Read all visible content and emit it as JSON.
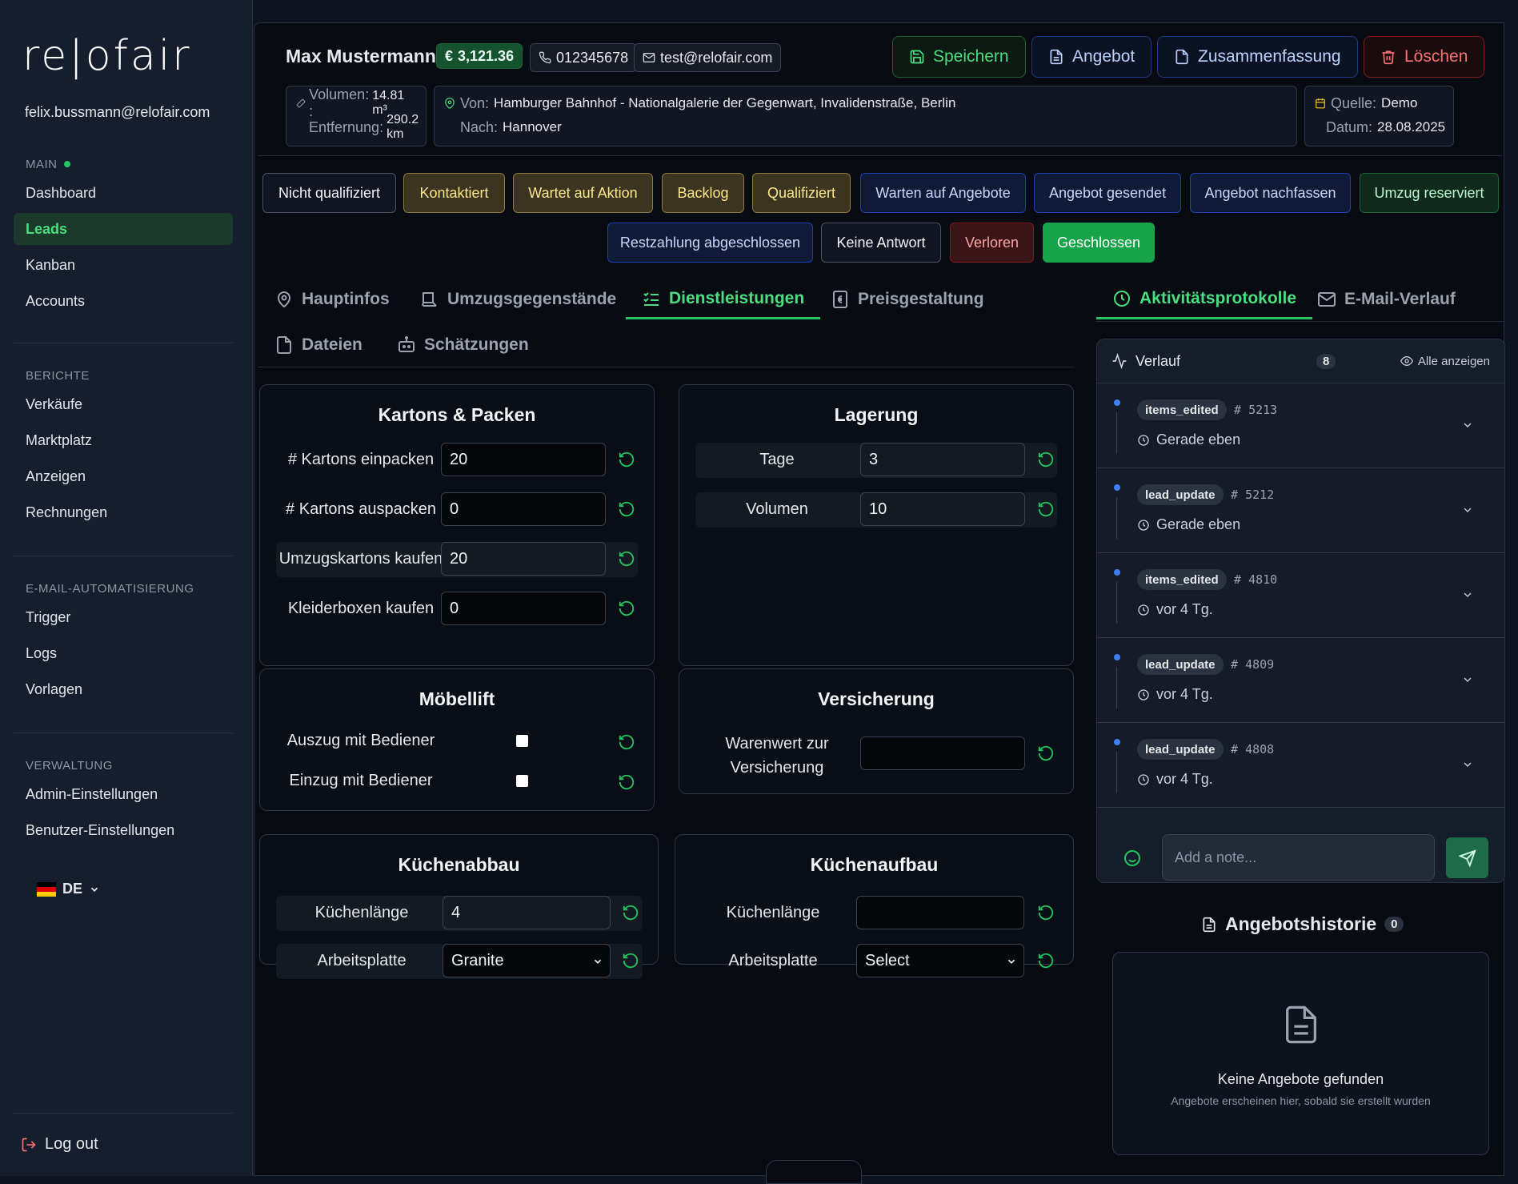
{
  "sidebar": {
    "logo": "re|ofair",
    "user_email": "felix.bussmann@relofair.com",
    "sections": [
      {
        "heading": "MAIN",
        "items": [
          {
            "label": "Dashboard"
          },
          {
            "label": "Leads"
          },
          {
            "label": "Kanban"
          },
          {
            "label": "Accounts"
          }
        ]
      },
      {
        "heading": "BERICHTE",
        "items": [
          {
            "label": "Verkäufe"
          },
          {
            "label": "Marktplatz"
          },
          {
            "label": "Anzeigen"
          },
          {
            "label": "Rechnungen"
          }
        ]
      },
      {
        "heading": "E-MAIL-AUTOMATISIERUNG",
        "items": [
          {
            "label": "Trigger"
          },
          {
            "label": "Logs"
          },
          {
            "label": "Vorlagen"
          }
        ]
      },
      {
        "heading": "VERWALTUNG",
        "items": [
          {
            "label": "Admin-Einstellungen"
          },
          {
            "label": "Benutzer-Einstellungen"
          }
        ]
      }
    ],
    "language": "DE",
    "logout": "Log out"
  },
  "header": {
    "name": "Max Mustermann",
    "price": "3,121.36",
    "currency": "€",
    "phone": "012345678",
    "email": "test@relofair.com",
    "buttons": {
      "save": "Speichern",
      "offer": "Angebot",
      "summary": "Zusammenfassung",
      "delete": "Löschen"
    },
    "volume_label": "Volumen: :",
    "volume_value": "14.81 m³",
    "distance_label": "Entfernung:",
    "distance_value": "290.2 km",
    "from_label": "Von:",
    "from_value": "Hamburger Bahnhof - Nationalgalerie der Gegenwart, Invalidenstraße, Berlin",
    "to_label": "Nach:",
    "to_value": "Hannover",
    "source_label": "Quelle:",
    "source_value": "Demo",
    "date_label": "Datum:",
    "date_value": "28.08.2025"
  },
  "stages": [
    {
      "label": "Nicht qualifiziert"
    },
    {
      "label": "Kontaktiert"
    },
    {
      "label": "Wartet auf Aktion"
    },
    {
      "label": "Backlog"
    },
    {
      "label": "Qualifiziert"
    },
    {
      "label": "Warten auf Angebote"
    },
    {
      "label": "Angebot gesendet"
    },
    {
      "label": "Angebot nachfassen"
    },
    {
      "label": "Umzug reserviert"
    },
    {
      "label": "Restzahlung abgeschlossen"
    },
    {
      "label": "Keine Antwort"
    },
    {
      "label": "Verloren"
    },
    {
      "label": "Geschlossen"
    }
  ],
  "tabs": [
    "Hauptinfos",
    "Umzugsgegenstände",
    "Dienstleistungen",
    "Preisgestaltung",
    "Dateien",
    "Schätzungen"
  ],
  "right_tabs": [
    "Aktivitätsprotokolle",
    "E-Mail-Verlauf"
  ],
  "services": {
    "kartons": {
      "title": "Kartons & Packen",
      "rows": [
        {
          "label": "# Kartons einpacken",
          "value": "20"
        },
        {
          "label": "# Kartons auspacken",
          "value": "0"
        },
        {
          "label": "Umzugskartons kaufen",
          "value": "20"
        },
        {
          "label": "Kleiderboxen kaufen",
          "value": "0"
        }
      ]
    },
    "lagerung": {
      "title": "Lagerung",
      "rows": [
        {
          "label": "Tage",
          "value": "3"
        },
        {
          "label": "Volumen",
          "value": "10"
        }
      ]
    },
    "moebellift": {
      "title": "Möbellift",
      "rows": [
        {
          "label": "Auszug mit Bediener",
          "checked": false
        },
        {
          "label": "Einzug mit Bediener",
          "checked": false
        }
      ]
    },
    "versicherung": {
      "title": "Versicherung",
      "row_label_1": "Warenwert zur",
      "row_label_2": "Versicherung",
      "value": ""
    },
    "kuechenabbau": {
      "title": "Küchenabbau",
      "length_label": "Küchenlänge",
      "length_value": "4",
      "counter_label": "Arbeitsplatte",
      "counter_value": "Granite"
    },
    "kuechenaufbau": {
      "title": "Küchenaufbau",
      "length_label": "Küchenlänge",
      "length_value": "",
      "counter_label": "Arbeitsplatte",
      "counter_value": "Select"
    }
  },
  "activity": {
    "title": "Verlauf",
    "count": "8",
    "show_all": "Alle anzeigen",
    "items": [
      {
        "tag": "items_edited",
        "id": "5213",
        "time": "Gerade eben"
      },
      {
        "tag": "lead_update",
        "id": "5212",
        "time": "Gerade eben"
      },
      {
        "tag": "items_edited",
        "id": "4810",
        "time": "vor 4 Tg."
      },
      {
        "tag": "lead_update",
        "id": "4809",
        "time": "vor 4 Tg."
      },
      {
        "tag": "lead_update",
        "id": "4808",
        "time": "vor 4 Tg."
      }
    ],
    "note_placeholder": "Add a note..."
  },
  "offer_history": {
    "title": "Angebotshistorie",
    "count": "0",
    "empty_title": "Keine Angebote gefunden",
    "empty_sub": "Angebote erscheinen hier, sobald sie erstellt wurden"
  }
}
